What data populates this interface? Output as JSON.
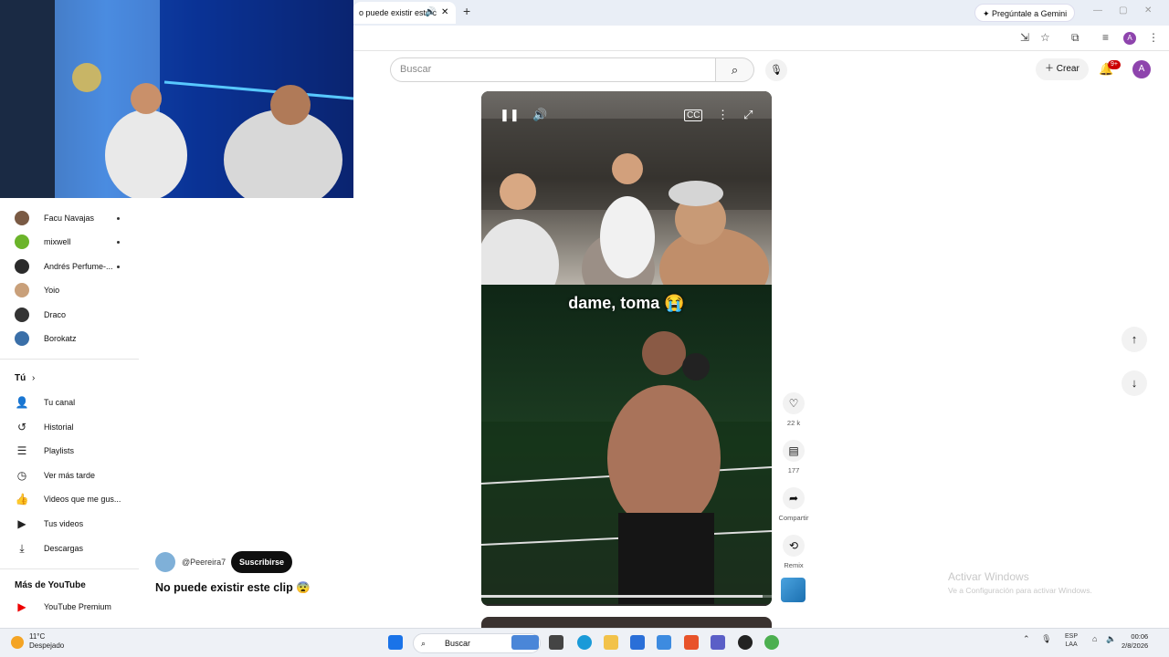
{
  "browser": {
    "tab_title": "o puede existir este c",
    "gemini_label": "Pregúntale a Gemini",
    "profile_initial": "A"
  },
  "header": {
    "search_placeholder": "Buscar",
    "create_label": "Crear",
    "notifications_badge": "9+",
    "avatar_initial": "A"
  },
  "sidebar": {
    "subscriptions": [
      {
        "name": "Facu Navajas",
        "live_dot": true,
        "color": "#7a5a44"
      },
      {
        "name": "mixwell",
        "live_dot": true,
        "color": "#6bb42a"
      },
      {
        "name": "Andrés Perfume-...",
        "live_dot": true,
        "color": "#2b2b2b"
      },
      {
        "name": "Yoio",
        "live_dot": false,
        "color": "#c9a07a"
      },
      {
        "name": "Draco",
        "live_dot": false,
        "color": "#333333"
      },
      {
        "name": "Borokatz",
        "live_dot": false,
        "color": "#3a6fa8"
      }
    ],
    "you_section_title": "Tú",
    "you_items": [
      {
        "label": "Tu canal",
        "icon": "person-icon"
      },
      {
        "label": "Historial",
        "icon": "history-icon"
      },
      {
        "label": "Playlists",
        "icon": "playlists-icon"
      },
      {
        "label": "Ver más tarde",
        "icon": "clock-icon"
      },
      {
        "label": "Videos que me gus...",
        "icon": "thumb-up-icon"
      },
      {
        "label": "Tus videos",
        "icon": "video-icon"
      },
      {
        "label": "Descargas",
        "icon": "download-icon"
      }
    ],
    "more_section_title": "Más de YouTube",
    "more_items": [
      {
        "label": "YouTube Premium",
        "icon": "youtube-icon"
      }
    ]
  },
  "video": {
    "caption": "dame, toma 😭",
    "progress": 0.97,
    "channel": "@Peereira7",
    "subscribe_label": "Suscribirse",
    "title": "No puede existir este clip 😨"
  },
  "actions": {
    "like_count": "22 k",
    "comment_count": "177",
    "share_label": "Compartir",
    "remix_label": "Remix"
  },
  "watermark": {
    "line1": "Activar Windows",
    "line2": "Ve a Configuración para activar Windows."
  },
  "taskbar": {
    "temperature": "11°C",
    "weather": "Despejado",
    "search_placeholder": "Buscar",
    "lang1": "ESP",
    "lang2": "LAA",
    "time": "00:06",
    "date": "2/8/2026"
  }
}
